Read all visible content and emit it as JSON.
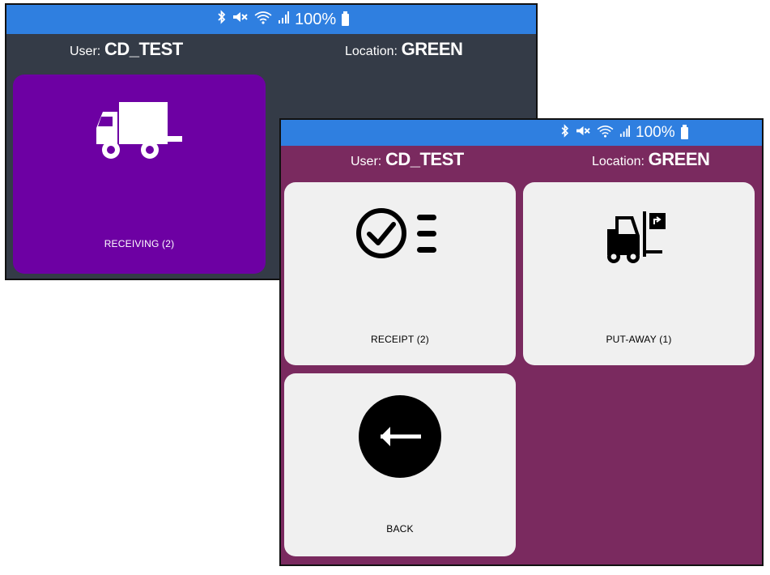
{
  "back_screen": {
    "status": {
      "battery": "100%",
      "icons": [
        "bluetooth-icon",
        "mute-icon",
        "wifi-icon",
        "signal-icon",
        "battery-icon"
      ]
    },
    "header": {
      "user_key": "User:",
      "user_value": "CD_TEST",
      "location_key": "Location:",
      "location_value": "GREEN"
    },
    "tiles": [
      {
        "label": "RECEIVING (2)",
        "icon": "truck-icon"
      }
    ],
    "colors": {
      "background": "#343b47",
      "statusbar": "#2f7fe0",
      "tile": "#6d00a3"
    }
  },
  "front_screen": {
    "status": {
      "battery": "100%",
      "icons": [
        "bluetooth-icon",
        "mute-icon",
        "wifi-icon",
        "signal-icon",
        "battery-icon"
      ]
    },
    "header": {
      "user_key": "User:",
      "user_value": "CD_TEST",
      "location_key": "Location:",
      "location_value": "GREEN"
    },
    "tiles": [
      {
        "label": "RECEIPT (2)",
        "icon": "checklist-icon"
      },
      {
        "label": "PUT-AWAY (1)",
        "icon": "forklift-icon"
      },
      {
        "label": "BACK",
        "icon": "back-arrow-icon"
      }
    ],
    "colors": {
      "background": "#7a2a5f",
      "statusbar": "#2f7fe0",
      "tile": "#f0f0f0"
    }
  }
}
